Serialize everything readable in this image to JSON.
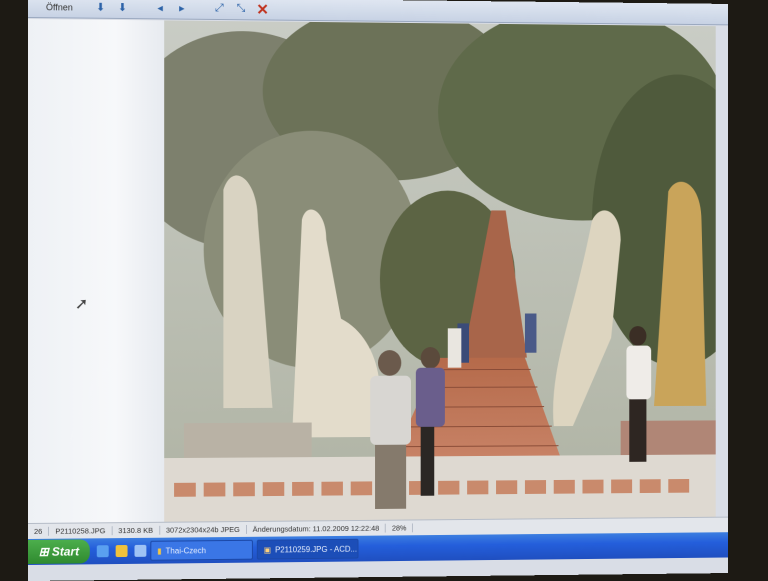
{
  "toolbar": {
    "open_label": "Öffnen",
    "icons": [
      "save-icon",
      "save-as-icon",
      "prev-icon",
      "next-icon",
      "zoom-in-icon",
      "zoom-out-icon",
      "close-icon"
    ]
  },
  "statusbar": {
    "index": "26",
    "filename": "P2110258.JPG",
    "filesize": "3130.8 KB",
    "dimensions": "3072x2304x24b JPEG",
    "modified": "Änderungsdatum: 11.02.2009 12:22:48",
    "zoom": "28%"
  },
  "taskbar": {
    "start_label": "Start",
    "tasks": [
      "Thai-Czech",
      "P2110259.JPG - ACD..."
    ]
  },
  "colors": {
    "taskbar_blue": "#245edb",
    "start_green": "#2f8a2f",
    "close_red": "#c0321e"
  }
}
